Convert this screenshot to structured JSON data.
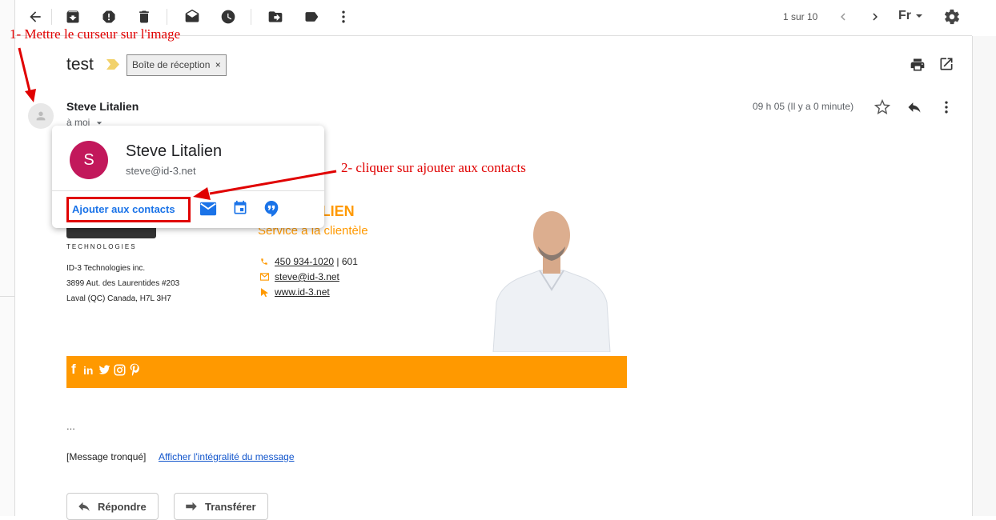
{
  "toolbar": {
    "back_icon": "arrow-left-icon",
    "archive_icon": "archive-icon",
    "spam_icon": "report-spam-icon",
    "delete_icon": "trash-icon",
    "mark_unread_icon": "mark-unread-icon",
    "snooze_icon": "clock-icon",
    "move_icon": "move-to-icon",
    "label_icon": "label-icon",
    "more_icon": "more-vert-icon",
    "pagination": "1 sur 10",
    "language": "Fr",
    "settings_icon": "gear-icon"
  },
  "email": {
    "subject": "test",
    "label": "Boîte de réception",
    "label_remove": "×",
    "sender": "Steve Litalien",
    "to": "à moi",
    "time": "09 h 05 (Il y a 0 minute)"
  },
  "popup": {
    "initial": "S",
    "name": "Steve Litalien",
    "email": "steve@id-3.net",
    "add_contact": "Ajouter aux contacts"
  },
  "signature": {
    "name_partial": "TALIEN",
    "title": "Service à la clientèle",
    "company": "TECHNOLOGIES",
    "address": [
      "ID-3 Technologies inc.",
      "3899 Aut. des Laurentides #203",
      "Laval (QC) Canada, H7L 3H7"
    ],
    "phone": "450 934-1020",
    "phone_ext": "| 601",
    "email": "steve@id-3.net",
    "website": "www.id-3.net",
    "social": [
      "f",
      "in"
    ]
  },
  "body": {
    "ellipsis": "...",
    "truncated": "[Message tronqué]",
    "full_link": "Afficher l'intégralité du message"
  },
  "actions": {
    "reply": "Répondre",
    "forward": "Transférer"
  },
  "annotations": {
    "step1": "1- Mettre le curseur sur l'image",
    "step2": "2- cliquer sur ajouter aux contacts"
  },
  "colors": {
    "accent_orange": "#ff9900",
    "avatar_color": "#c2185b",
    "link_blue": "#1a73e8",
    "annotation_red": "#e00000"
  }
}
